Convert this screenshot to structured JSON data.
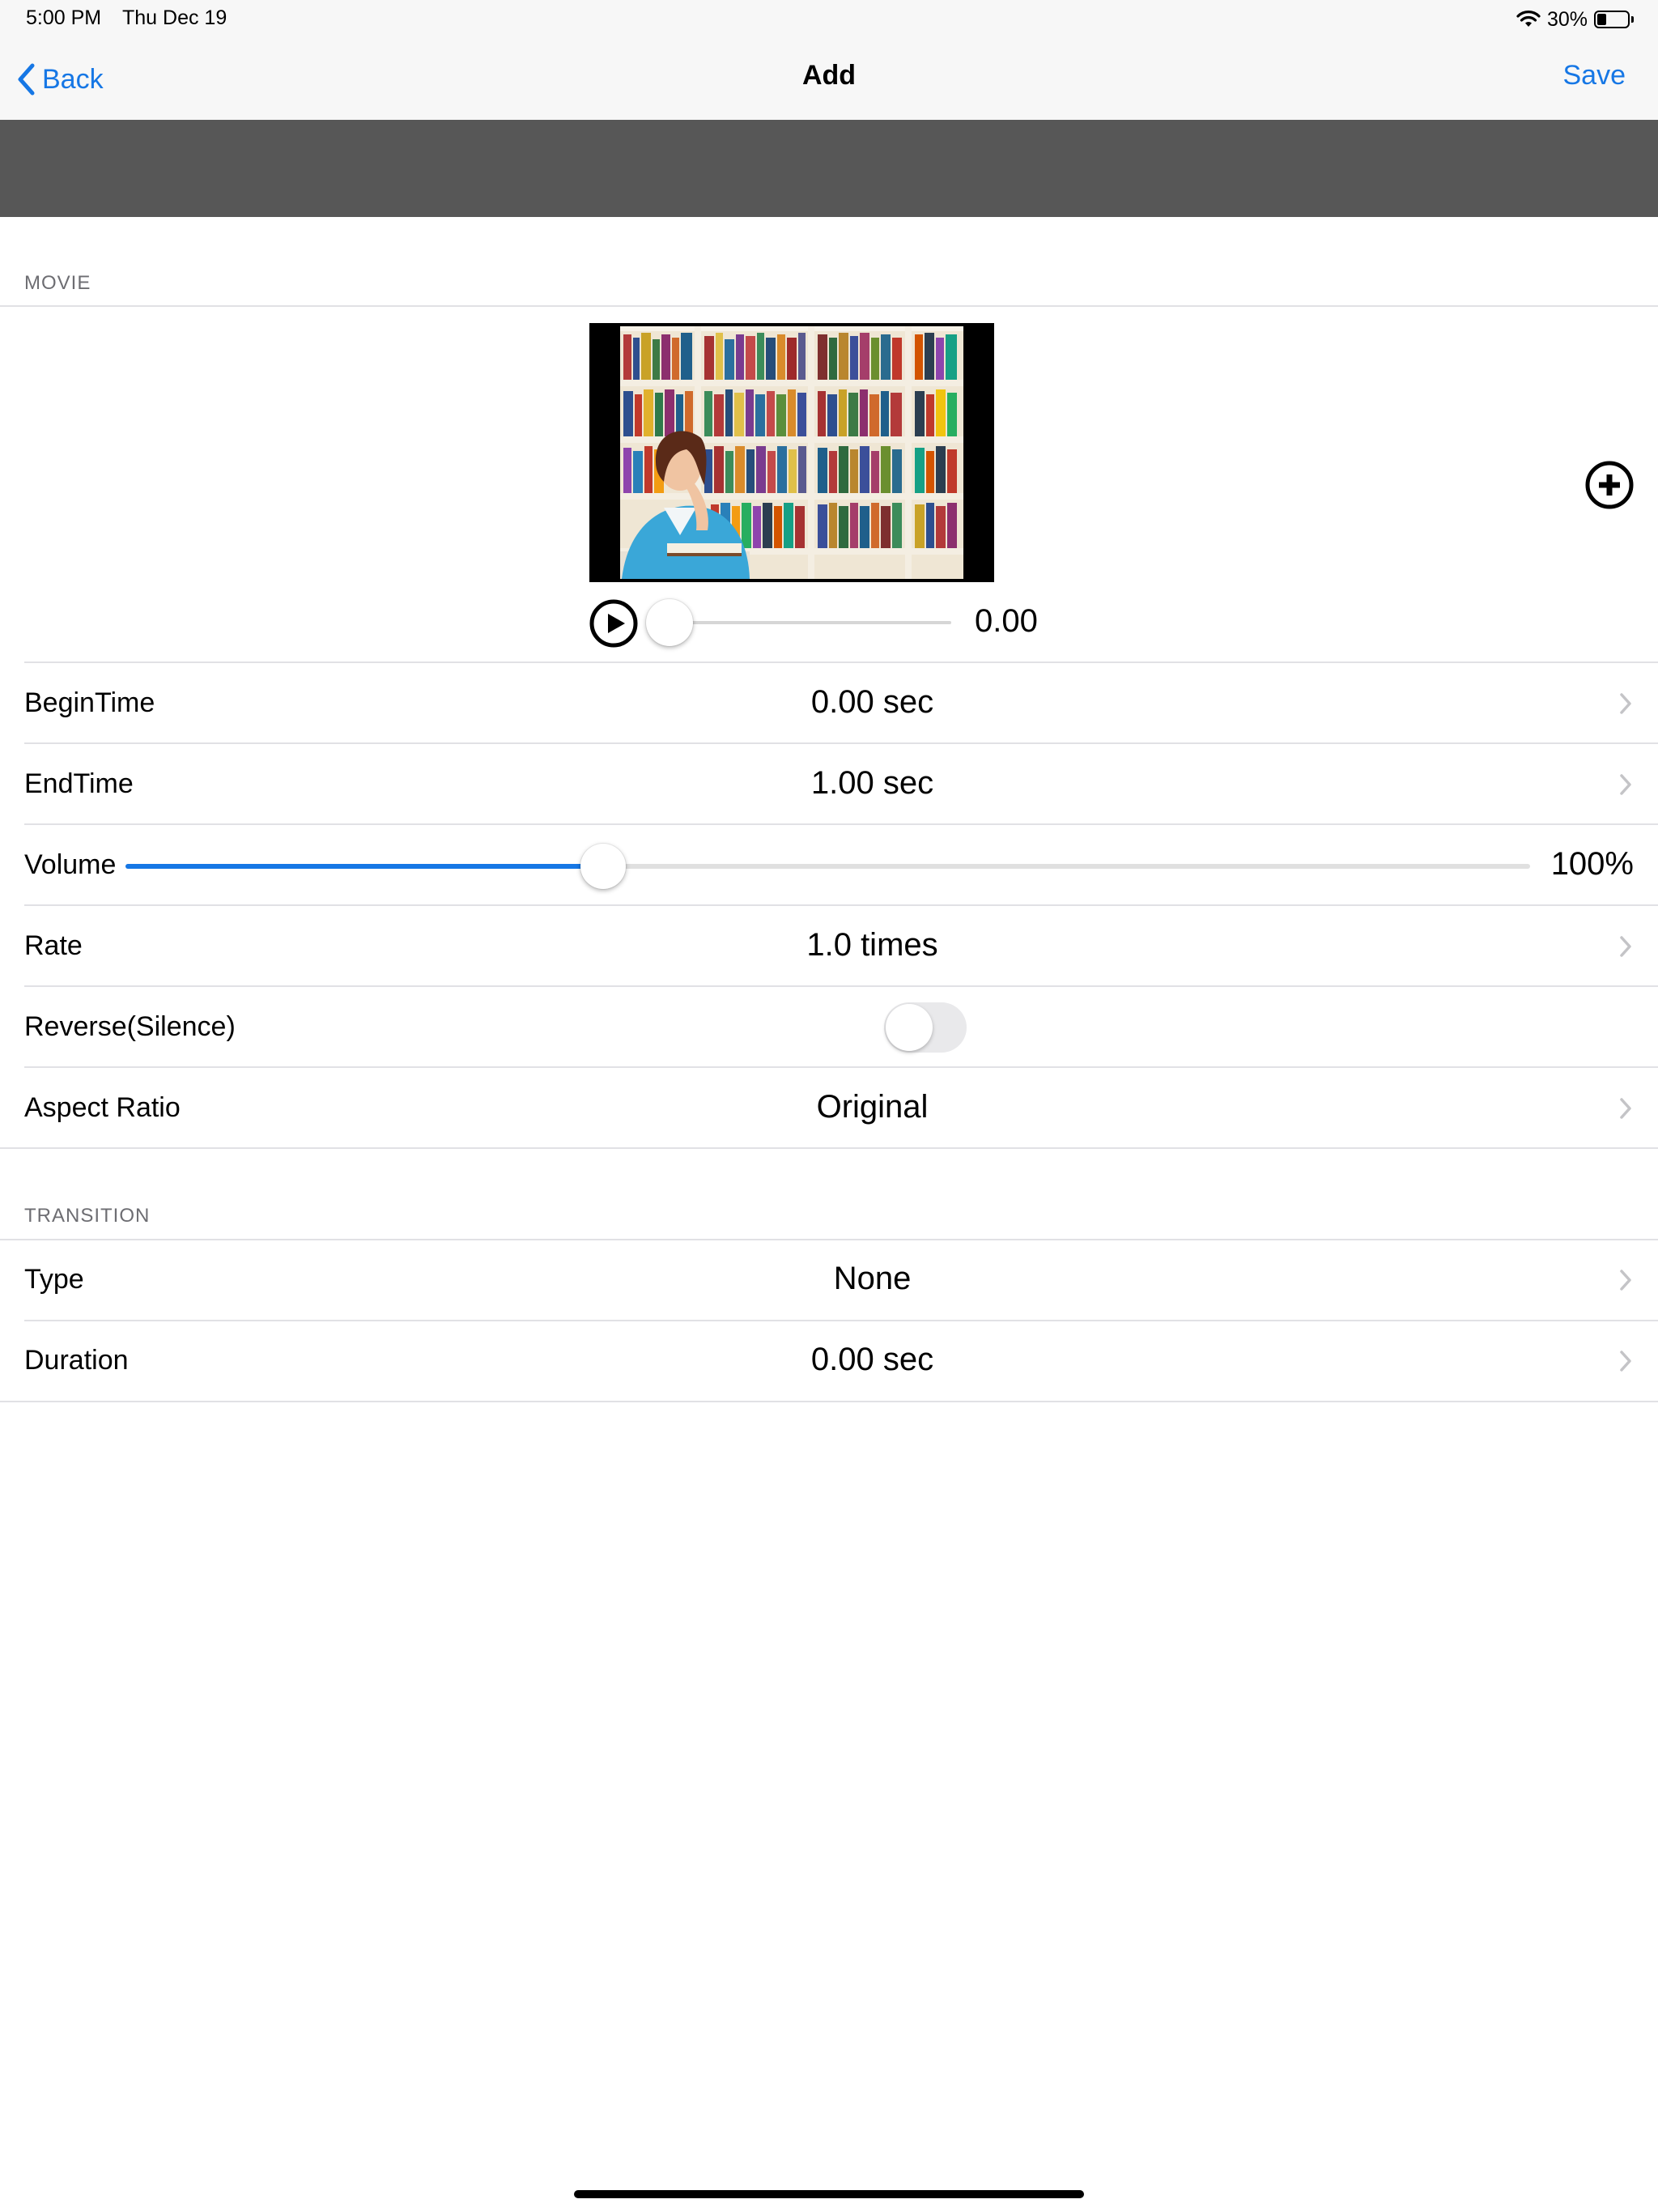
{
  "status_bar": {
    "time": "5:00 PM",
    "date": "Thu Dec 19",
    "battery": "30%",
    "battery_level": 0.3
  },
  "nav": {
    "back_label": "Back",
    "title": "Add",
    "save_label": "Save"
  },
  "movie": {
    "section_title": "MOVIE",
    "scrub_value": "0.00",
    "scrub_position": 0.0
  },
  "rows": {
    "begin_time": {
      "label": "BeginTime",
      "value": "0.00 sec"
    },
    "end_time": {
      "label": "EndTime",
      "value": "1.00 sec"
    },
    "volume": {
      "label": "Volume",
      "value": "100%",
      "slider_level": 0.34
    },
    "rate": {
      "label": "Rate",
      "value": "1.0 times"
    },
    "reverse": {
      "label": "Reverse(Silence)",
      "on": false
    },
    "aspect_ratio": {
      "label": "Aspect Ratio",
      "value": "Original"
    }
  },
  "transition": {
    "section_title": "TRANSITION",
    "type": {
      "label": "Type",
      "value": "None"
    },
    "duration": {
      "label": "Duration",
      "value": "0.00 sec"
    }
  },
  "colors": {
    "accent": "#1677e5",
    "banner": "#575757",
    "separator": "#e1e1e5"
  }
}
